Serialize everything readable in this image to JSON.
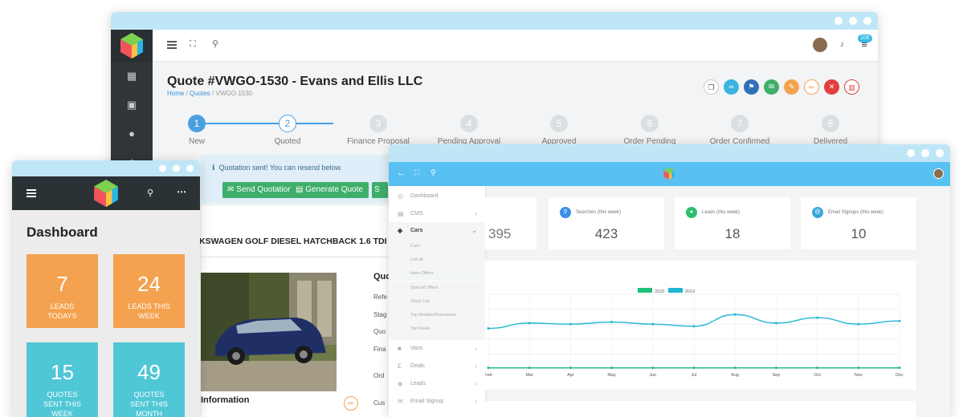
{
  "quote_window": {
    "title": "Quote #VWGO-1530 - Evans and Ellis LLC",
    "breadcrumb": [
      "Home",
      "Quotes",
      "VWGO-1530"
    ],
    "notification_count": "106",
    "steps": [
      {
        "num": "1",
        "label": "New"
      },
      {
        "num": "2",
        "label": "Quoted"
      },
      {
        "num": "3",
        "label": "Finance Proposal"
      },
      {
        "num": "4",
        "label": "Pending Approval"
      },
      {
        "num": "5",
        "label": "Approved"
      },
      {
        "num": "6",
        "label": "Order Pending"
      },
      {
        "num": "7",
        "label": "Order Confirmed"
      },
      {
        "num": "8",
        "label": "Delivered"
      }
    ],
    "alert": "Quotation sent! You can resend below.",
    "buttons": {
      "send": "Send Quotation",
      "generate": "Generate Quote PDF",
      "third": "S"
    },
    "vehicle_title": "KSWAGEN GOLF DIESEL HATCHBACK 1.6 TDI",
    "info_heading": "Information",
    "quote_heading": "Quot",
    "quote_rows": [
      "Refe",
      "Stag",
      "Quo",
      "Fina",
      "Ord",
      "Cus"
    ],
    "colors": {
      "step_active": "#4a9fe0",
      "step_inactive": "#dcdfe1",
      "send_button": "#3fae6a"
    },
    "action_icons": [
      "copy-icon",
      "link-icon",
      "flag-icon",
      "envelope-icon",
      "edit-icon",
      "pencil-icon",
      "close-icon",
      "trash-icon"
    ]
  },
  "dashboard_window": {
    "title": "Dashboard",
    "tiles": [
      {
        "value": "7",
        "line1": "LEADS",
        "line2": "TODAYS",
        "line3": "",
        "color": "#f4a24f"
      },
      {
        "value": "24",
        "line1": "LEADS THIS",
        "line2": "WEEK",
        "line3": "",
        "color": "#f4a24f"
      },
      {
        "value": "15",
        "line1": "QUOTES",
        "line2": "SENT THIS",
        "line3": "WEEK",
        "color": "#4fc7d6"
      },
      {
        "value": "49",
        "line1": "QUOTES",
        "line2": "SENT THIS",
        "line3": "MONTH",
        "color": "#4fc7d6"
      }
    ]
  },
  "admin_window": {
    "menu": {
      "dashboard": "Dashboard",
      "cms": "CMS",
      "cars": "Cars",
      "cars_sub": [
        "Cars",
        "List all",
        "Hero Offers",
        "Special Offers",
        "Stock List",
        "Top Models/Derivatives",
        "Top Deals"
      ],
      "vans": "Vans",
      "deals": "Deals",
      "leads": "Leads",
      "email_signup": "Email Signup"
    },
    "cards": [
      {
        "label": "",
        "value": "395",
        "color": "#ffffff"
      },
      {
        "label": "Searches (this week)",
        "value": "423",
        "color": "#3a8fe8"
      },
      {
        "label": "Leads (this week)",
        "value": "18",
        "color": "#2fbf71"
      },
      {
        "label": "Email Signups (this week)",
        "value": "10",
        "color": "#3aa8d8"
      }
    ]
  },
  "chart_data": {
    "type": "line",
    "categories": [
      "Feb",
      "Mar",
      "Apr",
      "May",
      "Jun",
      "Jul",
      "Aug",
      "Sep",
      "Oct",
      "Nov",
      "Dec"
    ],
    "series": [
      {
        "name": "2020",
        "color": "#1fbf7a",
        "values": [
          1,
          1,
          1,
          1,
          1,
          1,
          1,
          1,
          1,
          1,
          1
        ]
      },
      {
        "name": "2019",
        "color": "#23b6d4",
        "values": [
          38,
          43,
          42,
          44,
          42,
          40,
          51,
          43,
          48,
          42,
          45
        ]
      }
    ],
    "ylim": [
      0,
      70
    ],
    "legend": "top-center",
    "grid": true
  }
}
